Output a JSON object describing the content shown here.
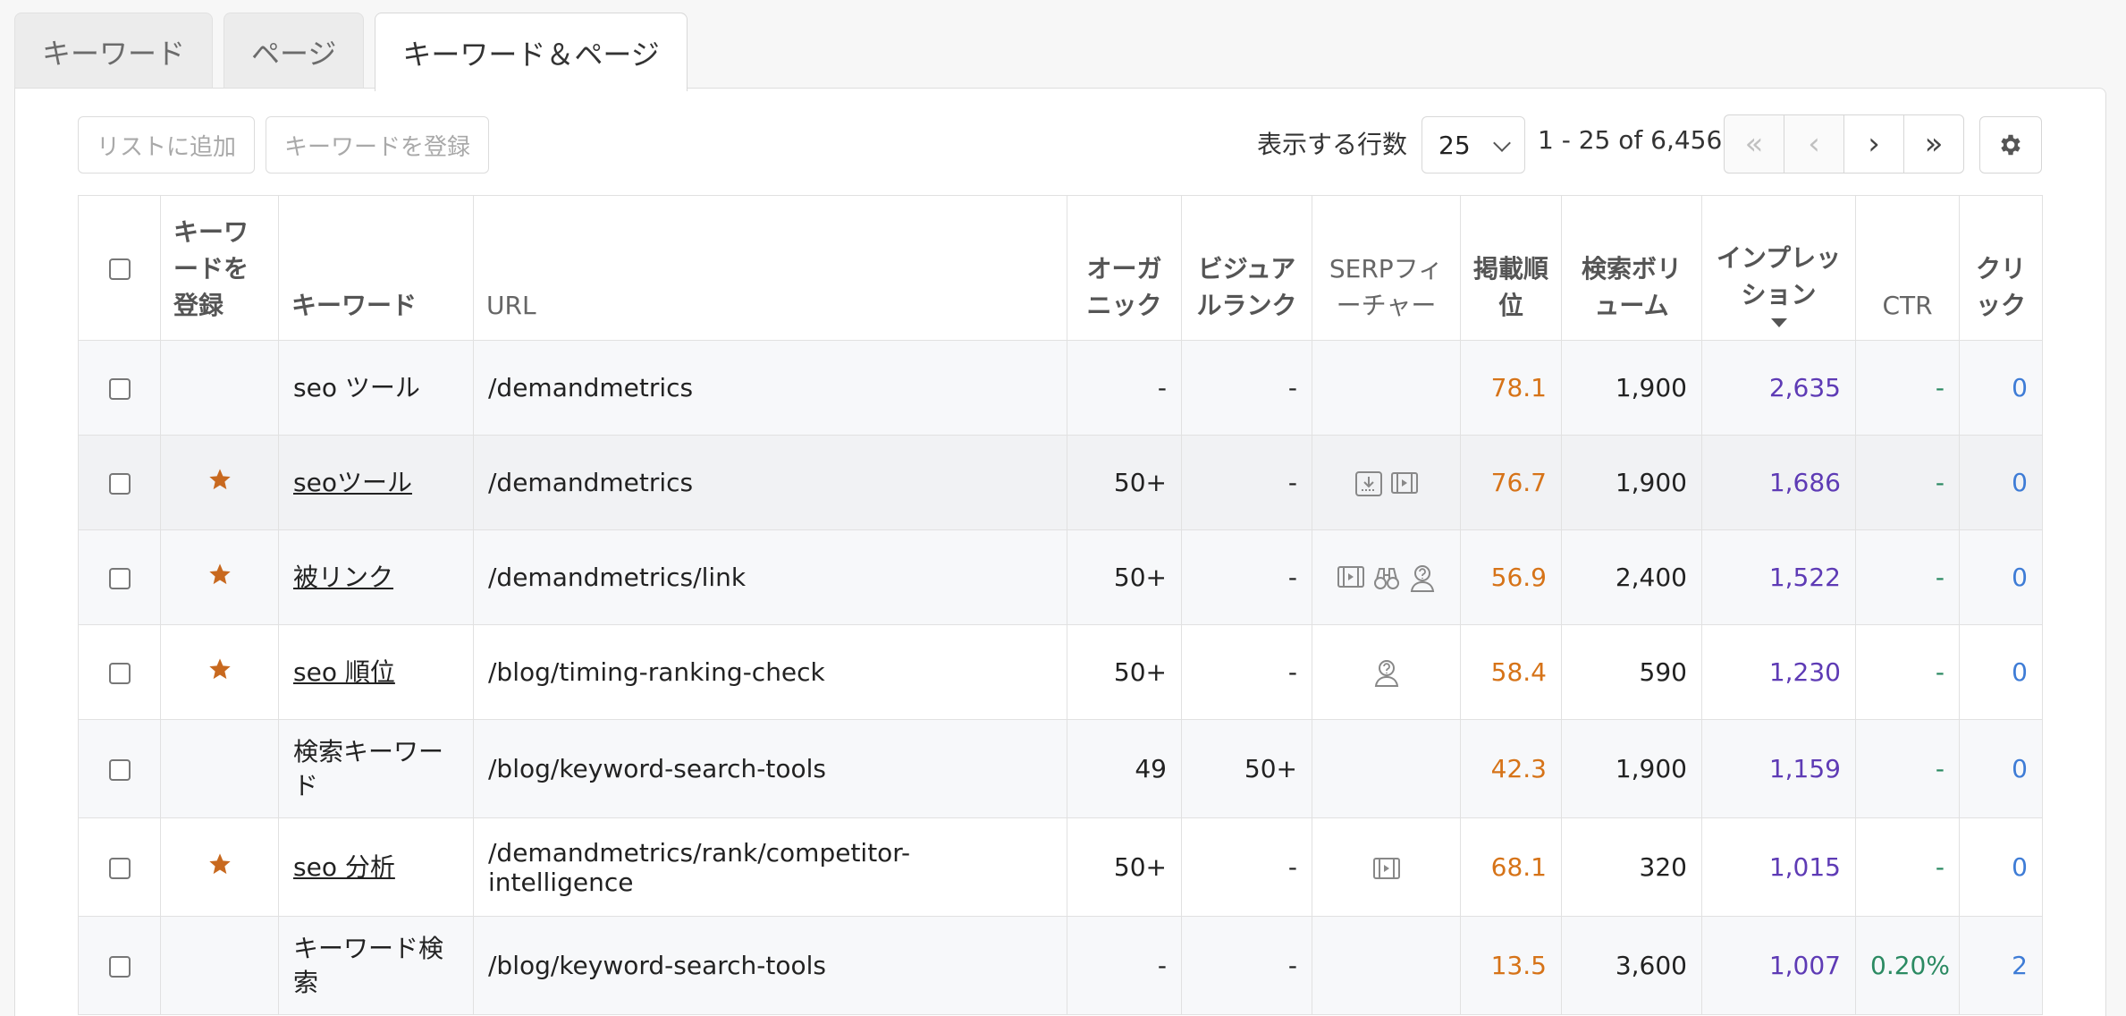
{
  "tabs": [
    {
      "label": "キーワード",
      "active": false
    },
    {
      "label": "ページ",
      "active": false
    },
    {
      "label": "キーワード＆ページ",
      "active": true
    }
  ],
  "toolbar": {
    "add_to_list": "リストに追加",
    "register_keyword": "キーワードを登録",
    "rows_label": "表示する行数",
    "rows_value": "25",
    "range_text": "1 - 25 of 6,456"
  },
  "pager": {
    "first": "«",
    "prev": "‹",
    "next": "›",
    "last": "»"
  },
  "columns": {
    "register": "キーワードを登録",
    "keyword": "キーワード",
    "url": "URL",
    "organic": "オーガニック",
    "visual_rank": "ビジュアルランク",
    "serp": "SERPフィーチャー",
    "position": "掲載順位",
    "volume": "検索ボリューム",
    "impressions": "インプレッション",
    "ctr": "CTR",
    "clicks": "クリック"
  },
  "rows": [
    {
      "starred": false,
      "keyword": "seo ツール",
      "linked": false,
      "url": "/demandmetrics",
      "organic": "-",
      "visual": "-",
      "serp": [],
      "position": "78.1",
      "volume": "1,900",
      "impressions": "2,635",
      "ctr": "-",
      "clicks": "0"
    },
    {
      "starred": true,
      "keyword": "seoツール",
      "linked": true,
      "url": "/demandmetrics",
      "organic": "50+",
      "visual": "-",
      "serp": [
        "download-icon",
        "video-icon"
      ],
      "position": "76.7",
      "volume": "1,900",
      "impressions": "1,686",
      "ctr": "-",
      "clicks": "0"
    },
    {
      "starred": true,
      "keyword": "被リンク",
      "linked": true,
      "url": "/demandmetrics/link",
      "organic": "50+",
      "visual": "-",
      "serp": [
        "video-icon",
        "binoculars-icon",
        "question-person-icon"
      ],
      "position": "56.9",
      "volume": "2,400",
      "impressions": "1,522",
      "ctr": "-",
      "clicks": "0"
    },
    {
      "starred": true,
      "keyword": "seo 順位",
      "linked": true,
      "url": "/blog/timing-ranking-check",
      "organic": "50+",
      "visual": "-",
      "serp": [
        "question-person-icon"
      ],
      "position": "58.4",
      "volume": "590",
      "impressions": "1,230",
      "ctr": "-",
      "clicks": "0"
    },
    {
      "starred": false,
      "keyword": "検索キーワード",
      "linked": false,
      "url": "/blog/keyword-search-tools",
      "organic": "49",
      "visual": "50+",
      "serp": [],
      "position": "42.3",
      "volume": "1,900",
      "impressions": "1,159",
      "ctr": "-",
      "clicks": "0"
    },
    {
      "starred": true,
      "keyword": "seo 分析",
      "linked": true,
      "url": "/demandmetrics/rank/competitor-intelligence",
      "organic": "50+",
      "visual": "-",
      "serp": [
        "video-icon"
      ],
      "position": "68.1",
      "volume": "320",
      "impressions": "1,015",
      "ctr": "-",
      "clicks": "0"
    },
    {
      "starred": false,
      "keyword": "キーワード検索",
      "linked": false,
      "url": "/blog/keyword-search-tools",
      "organic": "-",
      "visual": "-",
      "serp": [],
      "position": "13.5",
      "volume": "3,600",
      "impressions": "1,007",
      "ctr": "0.20%",
      "clicks": "2"
    }
  ],
  "colors": {
    "position": "#d67318",
    "impressions": "#5e3bb5",
    "ctr": "#2b8a62",
    "clicks": "#3e7cd6",
    "star": "#c8691f"
  }
}
